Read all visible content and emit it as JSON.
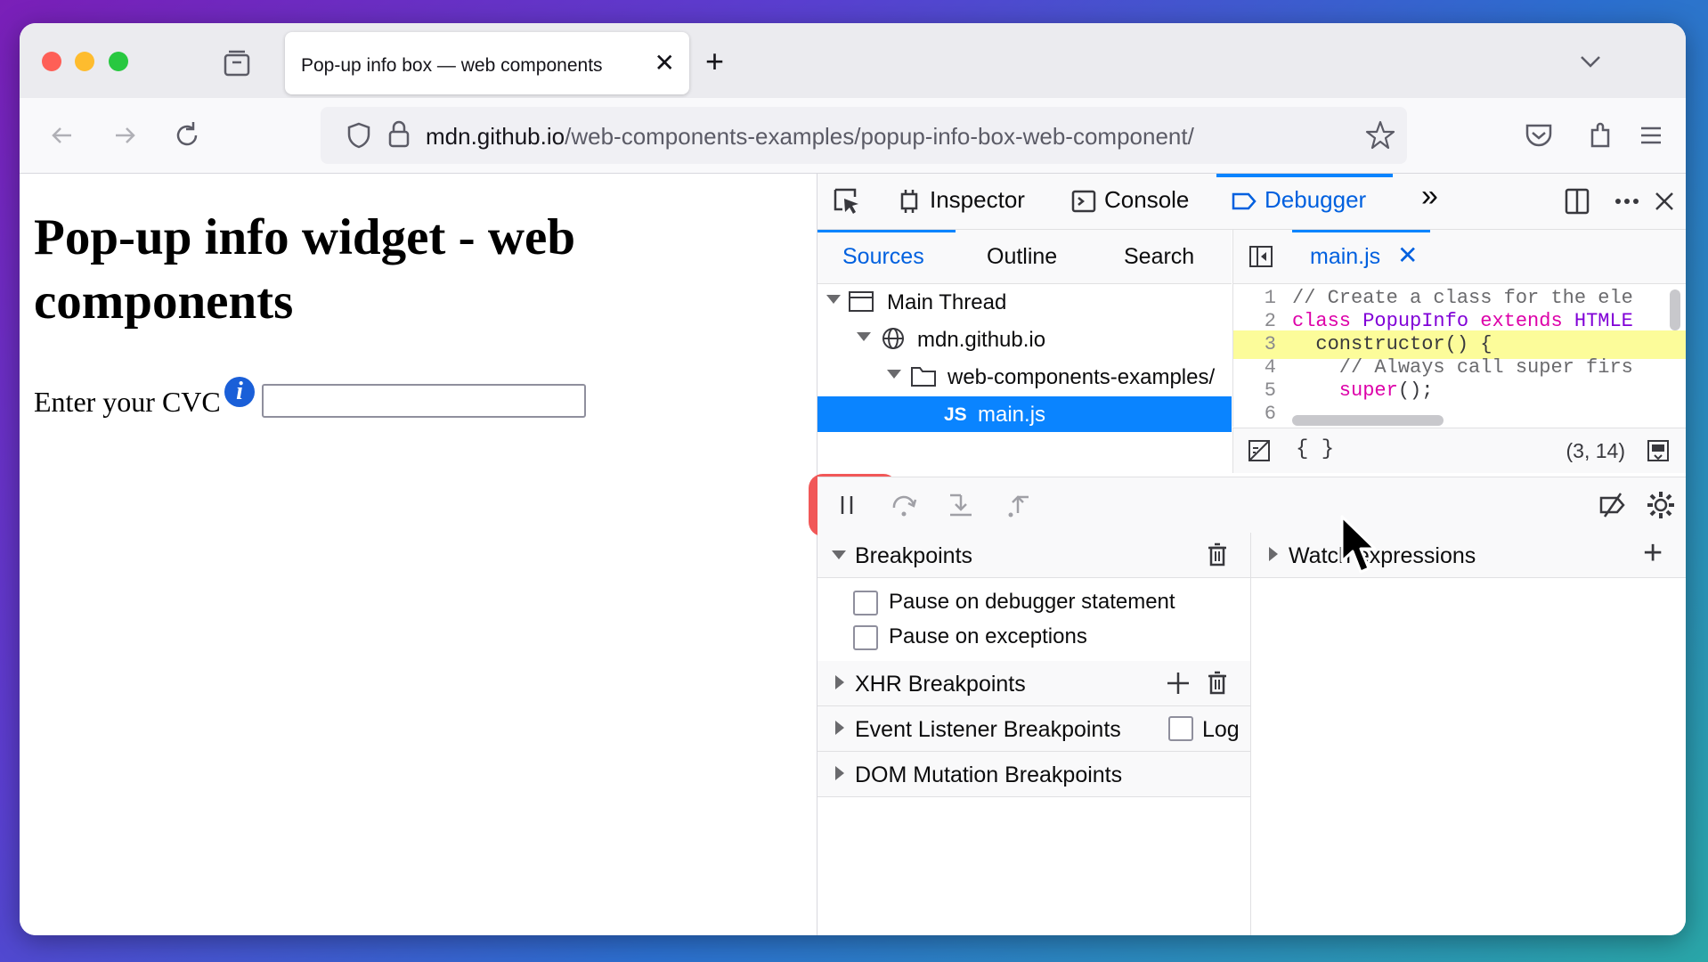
{
  "browser": {
    "tab": {
      "title": "Pop-up info box — web components",
      "close": "✕"
    },
    "new_tab": "+",
    "url": {
      "host": "mdn.github.io",
      "path": "/web-components-examples/popup-info-box-web-component/"
    }
  },
  "page": {
    "title": "Pop-up info widget - web components",
    "cvc_label": "Enter your CVC",
    "info_icon": "i",
    "cvc_value": ""
  },
  "devtools": {
    "tabs": {
      "inspector": "Inspector",
      "console": "Console",
      "debugger": "Debugger"
    },
    "more_tabs": "»",
    "sources_tabs": {
      "sources": "Sources",
      "outline": "Outline",
      "search": "Search"
    },
    "tree": {
      "main_thread": "Main Thread",
      "host": "mdn.github.io",
      "folder": "web-components-examples/",
      "file_badge": "JS",
      "file": "main.js"
    },
    "editor": {
      "tab_label": "main.js",
      "tab_close": "✕",
      "lines": [
        {
          "num": "1",
          "parts": [
            {
              "t": "// Create a class for the ele",
              "c": "cmt"
            }
          ]
        },
        {
          "num": "2",
          "parts": [
            {
              "t": "class ",
              "c": "kw"
            },
            {
              "t": "PopupInfo ",
              "c": "cls"
            },
            {
              "t": "extends ",
              "c": "kw"
            },
            {
              "t": "HTMLE",
              "c": "cls"
            }
          ]
        },
        {
          "num": "3",
          "parts": [
            {
              "t": "  constructor",
              "c": "plain"
            },
            {
              "t": "() {",
              "c": "plain"
            }
          ]
        },
        {
          "num": "4",
          "parts": [
            {
              "t": "    // Always call super firs",
              "c": "cmt"
            }
          ]
        },
        {
          "num": "5",
          "parts": [
            {
              "t": "    super",
              "c": "kw"
            },
            {
              "t": "();",
              "c": "plain"
            }
          ]
        },
        {
          "num": "6",
          "parts": [
            {
              "t": "",
              "c": "plain"
            }
          ]
        }
      ],
      "highlight_line": 3,
      "pretty_print": "{ }",
      "cursor_position": "(3, 14)"
    },
    "breakpoints": {
      "title": "Breakpoints",
      "pause_on_debugger": "Pause on debugger statement",
      "pause_on_exceptions": "Pause on exceptions",
      "xhr": "XHR Breakpoints",
      "event_listener": "Event Listener Breakpoints",
      "log": "Log",
      "dom_mutation": "DOM Mutation Breakpoints"
    },
    "watch": {
      "title": "Watch expressions",
      "add": "+"
    }
  },
  "colors": {
    "accent": "#0a84ff",
    "selected_text": "#0060df",
    "highlight": "#fcfc9a"
  }
}
